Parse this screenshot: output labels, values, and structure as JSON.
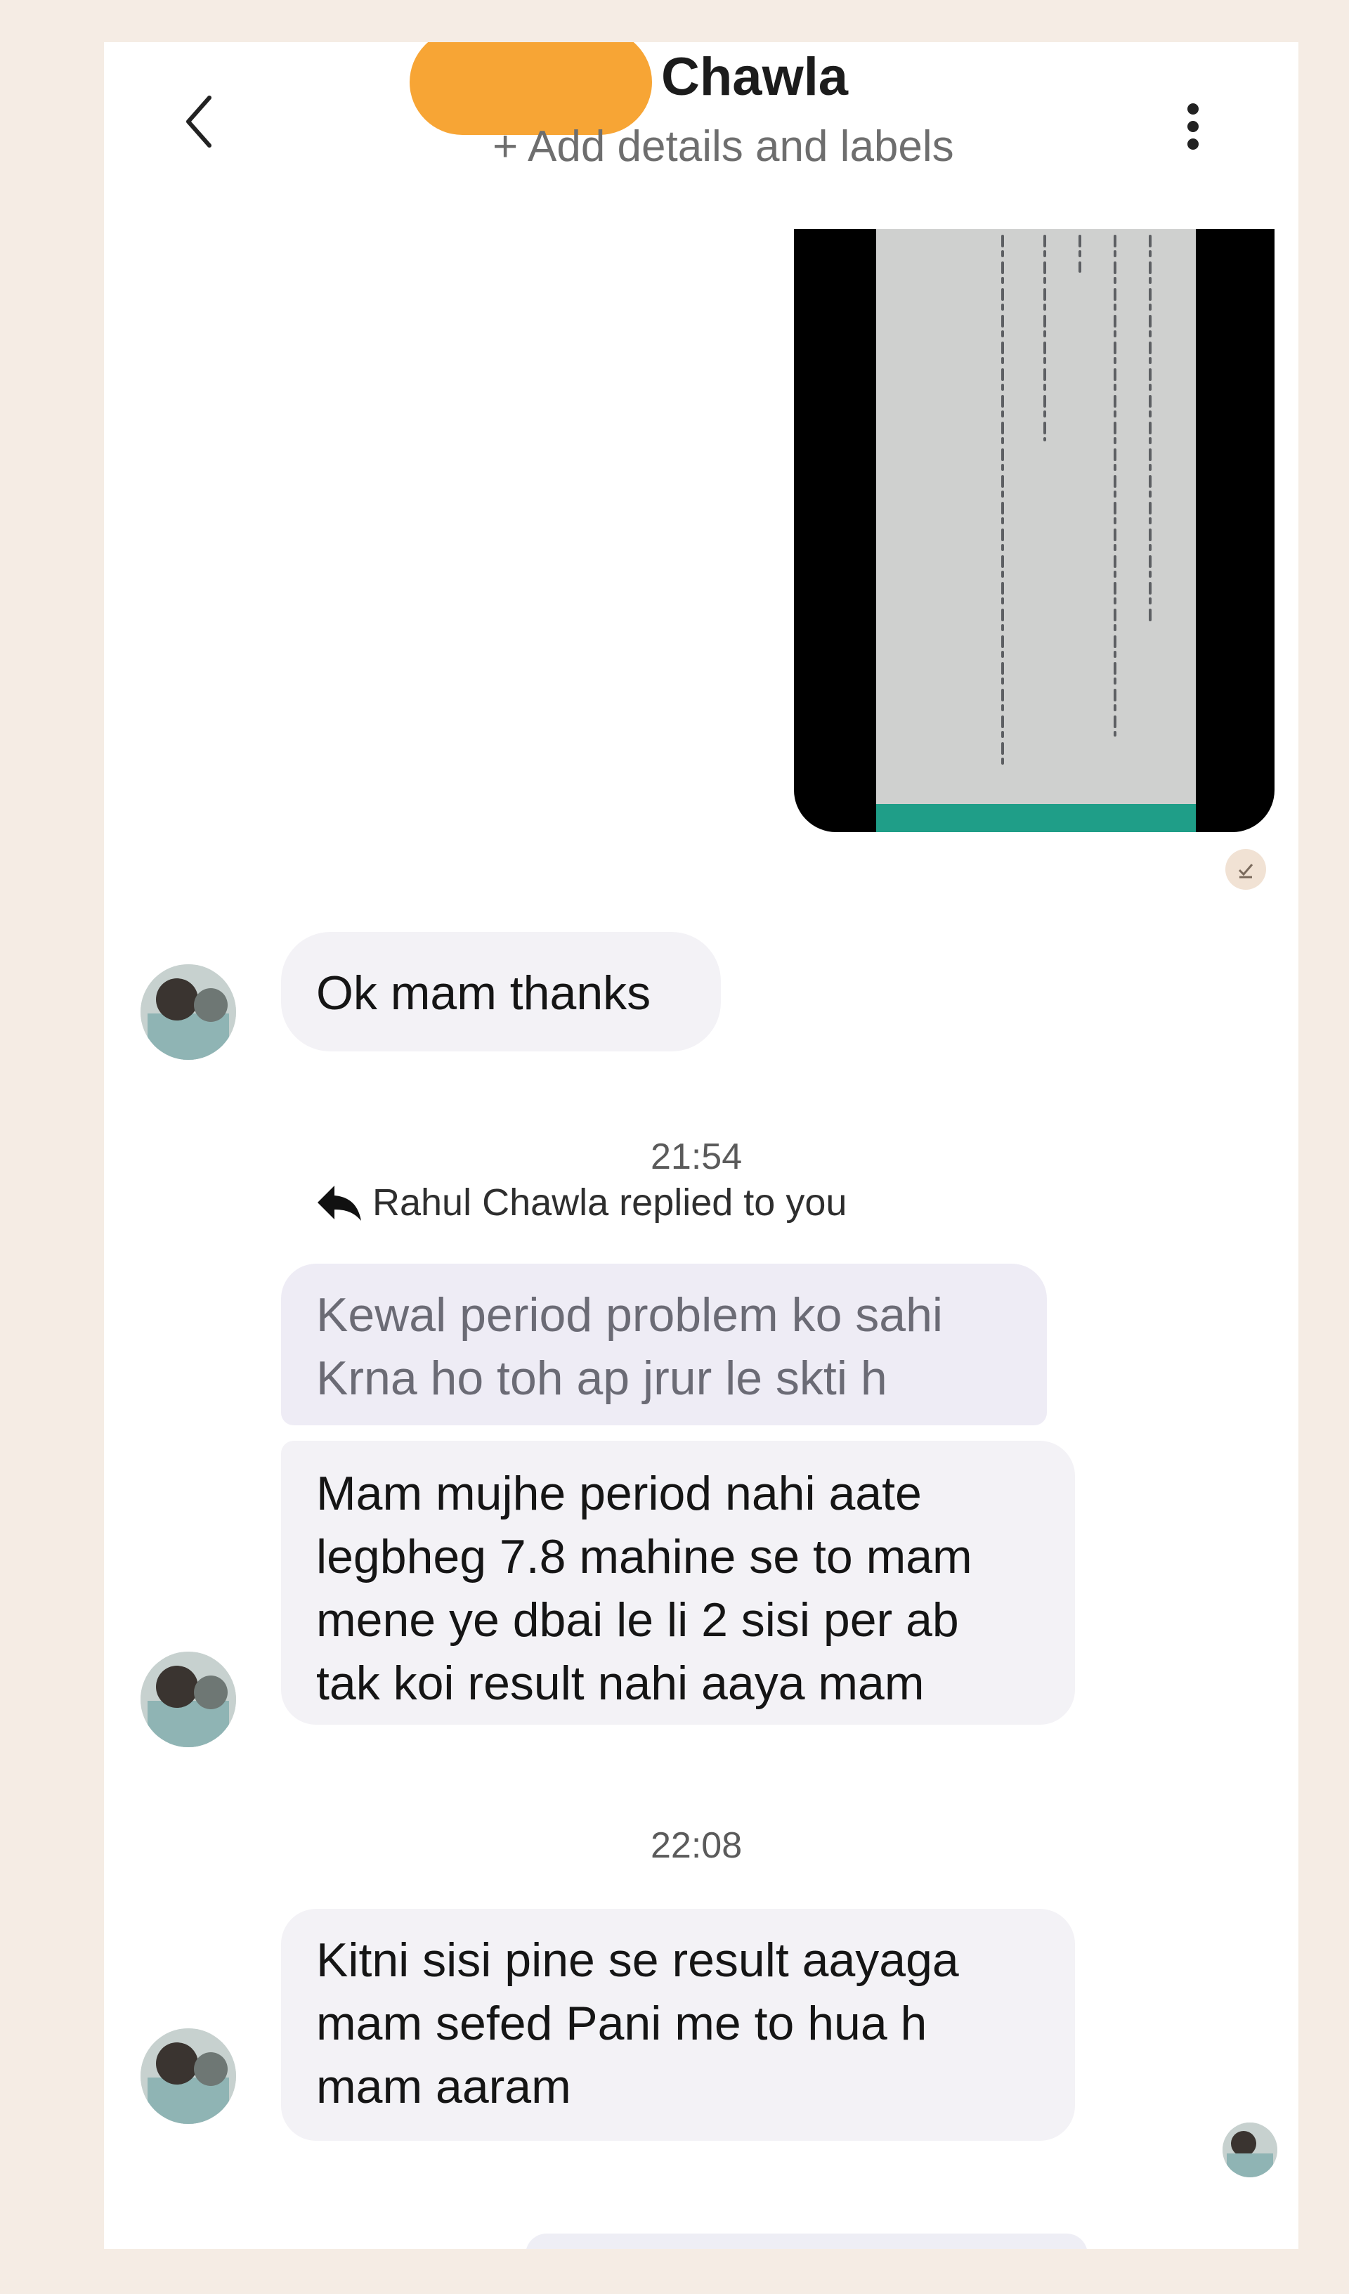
{
  "header": {
    "title": "Chawla",
    "subtitle": "+ Add details and labels",
    "back_icon": "chevron-left-icon",
    "menu_icon": "more-vertical-icon"
  },
  "messages": {
    "msg1": {
      "text": "Ok mam thanks"
    },
    "time1": "21:54",
    "reply_note": "Rahul Chawla replied to you",
    "quoted": [
      "Kewal period problem ko sahi",
      "Krna ho toh ap jrur le skti h"
    ],
    "msg2": [
      "Mam mujhe period nahi aate",
      "legbheg 7.8 mahine se to mam",
      "mene ye dbai le li 2 sisi per ab",
      "tak koi result nahi aaya mam"
    ],
    "time2": "22:08",
    "msg3": [
      "Kitni sisi pine se result aayaga",
      "mam sefed Pani me to hua h",
      "mam aaram"
    ]
  },
  "colors": {
    "background": "#f5ece4",
    "redaction": "#f7a535",
    "bubble": "#f3f2f6",
    "photo_teal": "#1f9e88"
  }
}
